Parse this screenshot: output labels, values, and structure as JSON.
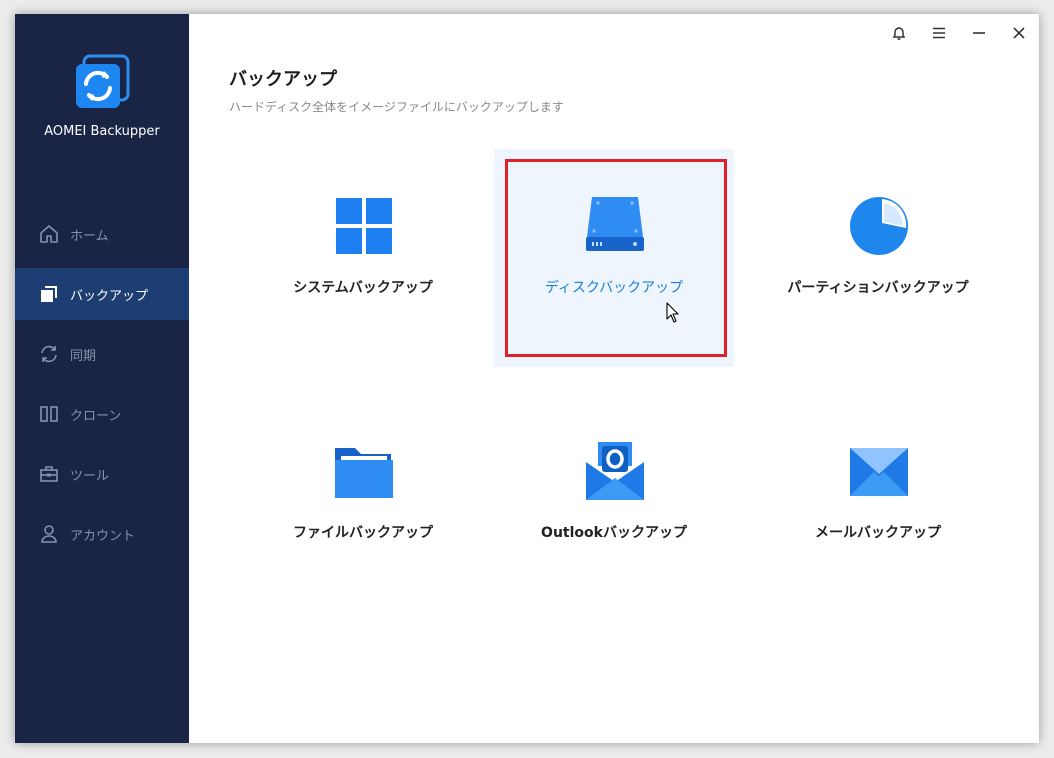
{
  "app": {
    "name": "AOMEI Backupper"
  },
  "sidebar": {
    "items": [
      {
        "label": "ホーム",
        "icon": "home-icon",
        "active": false
      },
      {
        "label": "バックアップ",
        "icon": "backup-icon",
        "active": true
      },
      {
        "label": "同期",
        "icon": "sync-icon",
        "active": false
      },
      {
        "label": "クローン",
        "icon": "clone-icon",
        "active": false
      },
      {
        "label": "ツール",
        "icon": "toolbox-icon",
        "active": false
      },
      {
        "label": "アカウント",
        "icon": "user-icon",
        "active": false
      }
    ]
  },
  "header": {
    "title": "バックアップ",
    "subtitle": "ハードディスク全体をイメージファイルにバックアップします"
  },
  "titlebar": {
    "buttons": [
      "bell-icon",
      "menu-icon",
      "minimize-icon",
      "close-icon"
    ]
  },
  "tiles": [
    {
      "label": "システムバックアップ",
      "icon": "windows-icon"
    },
    {
      "label": "ディスクバックアップ",
      "icon": "disk-icon",
      "selected": true
    },
    {
      "label": "パーティションバックアップ",
      "icon": "pie-icon"
    },
    {
      "label": "ファイルバックアップ",
      "icon": "folder-icon"
    },
    {
      "label": "Outlookバックアップ",
      "icon": "outlook-icon"
    },
    {
      "label": "メールバックアップ",
      "icon": "mail-icon"
    }
  ],
  "colors": {
    "sidebar": "#1a2444",
    "active": "#1d3e72",
    "accent": "#1a7fdb",
    "highlight": "#e0202a"
  }
}
